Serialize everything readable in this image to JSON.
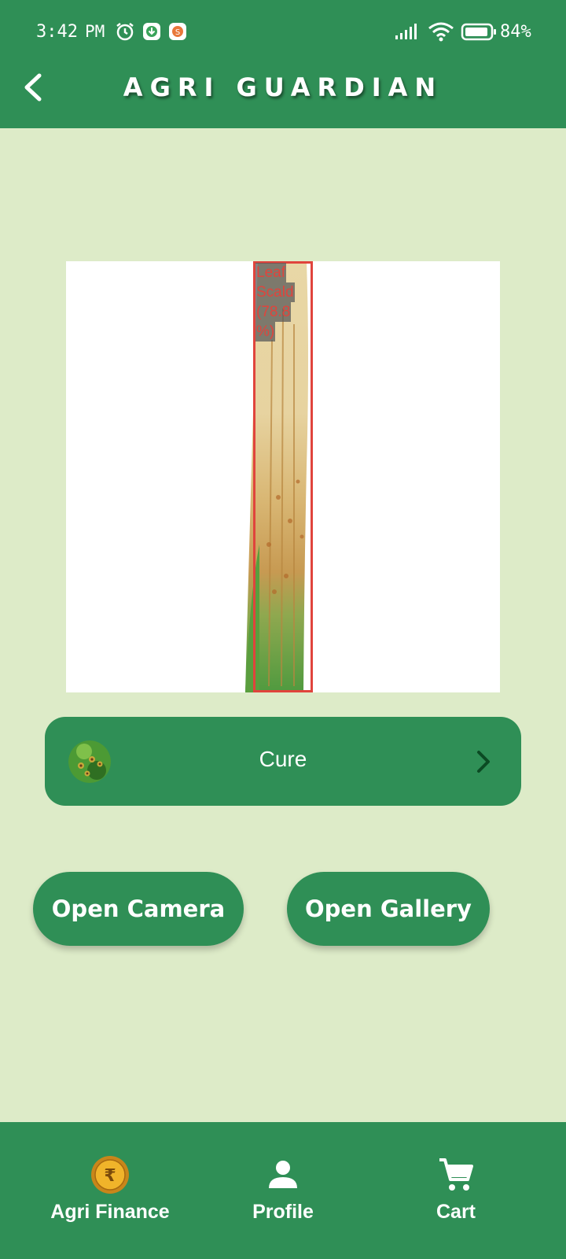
{
  "status_bar": {
    "time": "3:42",
    "ampm": "PM",
    "battery": "84"
  },
  "app_bar": {
    "title": "AGRI GUARDIAN",
    "back_icon": "back-chevron-icon"
  },
  "detection": {
    "label_lines": [
      "Leaf",
      "Scald",
      "(78.8",
      "%)"
    ],
    "box_color": "#e0443c"
  },
  "cure_button": {
    "label": "Cure",
    "chevron_icon": "chevron-right-icon"
  },
  "actions": {
    "camera_label": "Open Camera",
    "gallery_label": "Open Gallery"
  },
  "bottom_nav": {
    "items": [
      {
        "label": "Agri Finance",
        "icon": "rupee-coin-icon"
      },
      {
        "label": "Profile",
        "icon": "person-icon"
      },
      {
        "label": "Cart",
        "icon": "cart-icon"
      }
    ]
  },
  "colors": {
    "primary": "#2f8f56",
    "background": "#ddebc8"
  }
}
